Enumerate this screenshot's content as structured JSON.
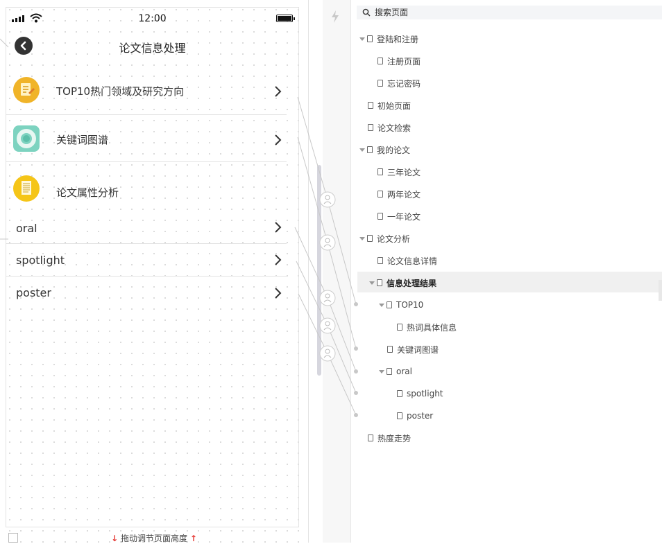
{
  "phone": {
    "status": {
      "time": "12:00"
    },
    "nav": {
      "title": "论文信息处理"
    },
    "rows": [
      {
        "label": "TOP10热门领域及研究方向",
        "icon": "notepad-icon",
        "color": "#f0b429"
      },
      {
        "label": "关键词图谱",
        "icon": "donut-chart-icon",
        "color": "#7dd3c0"
      },
      {
        "label": "论文属性分析",
        "icon": "document-icon",
        "color": "#f5c518"
      }
    ],
    "sub_rows": [
      "oral",
      "spotlight",
      "poster"
    ]
  },
  "bottom": {
    "hint": "拖动调节页面高度"
  },
  "tree": {
    "search_placeholder": "搜索页面",
    "items": [
      "登陆和注册",
      "注册页面",
      "忘记密码",
      "初始页面",
      "论文检索",
      "我的论文",
      "三年论文",
      "两年论文",
      "一年论文",
      "论文分析",
      "论文信息详情",
      "信息处理结果",
      "TOP10",
      "热词具体信息",
      "关键词图谱",
      "oral",
      "spotlight",
      "poster",
      "热度走势"
    ]
  }
}
